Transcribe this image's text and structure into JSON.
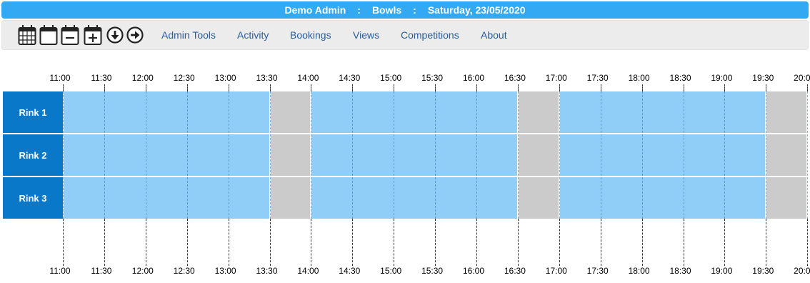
{
  "header": {
    "user": "Demo Admin",
    "separator": ":",
    "club": "Bowls",
    "date": "Saturday, 23/05/2020"
  },
  "toolbar": {
    "icons": [
      "calendar-grid-icon",
      "calendar-blank-icon",
      "calendar-minus-icon",
      "calendar-plus-icon",
      "arrow-down-circle-icon",
      "arrow-right-circle-icon"
    ],
    "nav": [
      "Admin Tools",
      "Activity",
      "Bookings",
      "Views",
      "Competitions",
      "About"
    ]
  },
  "timeline": {
    "ticks": [
      "11:00",
      "11:30",
      "12:00",
      "12:30",
      "13:00",
      "13:30",
      "14:00",
      "14:30",
      "15:00",
      "15:30",
      "16:00",
      "16:30",
      "17:00",
      "17:30",
      "18:00",
      "18:30",
      "19:00",
      "19:30",
      "20:00"
    ]
  },
  "rinks": [
    {
      "name": "Rink 1"
    },
    {
      "name": "Rink 2"
    },
    {
      "name": "Rink 3"
    }
  ],
  "slots": [
    {
      "start": "11:00",
      "end": "13:30",
      "status": "available"
    },
    {
      "start": "13:30",
      "end": "14:00",
      "status": "unavailable"
    },
    {
      "start": "14:00",
      "end": "16:30",
      "status": "available"
    },
    {
      "start": "16:30",
      "end": "17:00",
      "status": "unavailable"
    },
    {
      "start": "17:00",
      "end": "19:30",
      "status": "available"
    },
    {
      "start": "19:30",
      "end": "20:00",
      "status": "unavailable"
    }
  ],
  "colors": {
    "header": "#33a9f3",
    "rink_label": "#0a78c8",
    "available": "#90cdf7",
    "unavailable": "#cbcbcb",
    "nav_link": "#2a5d99"
  }
}
